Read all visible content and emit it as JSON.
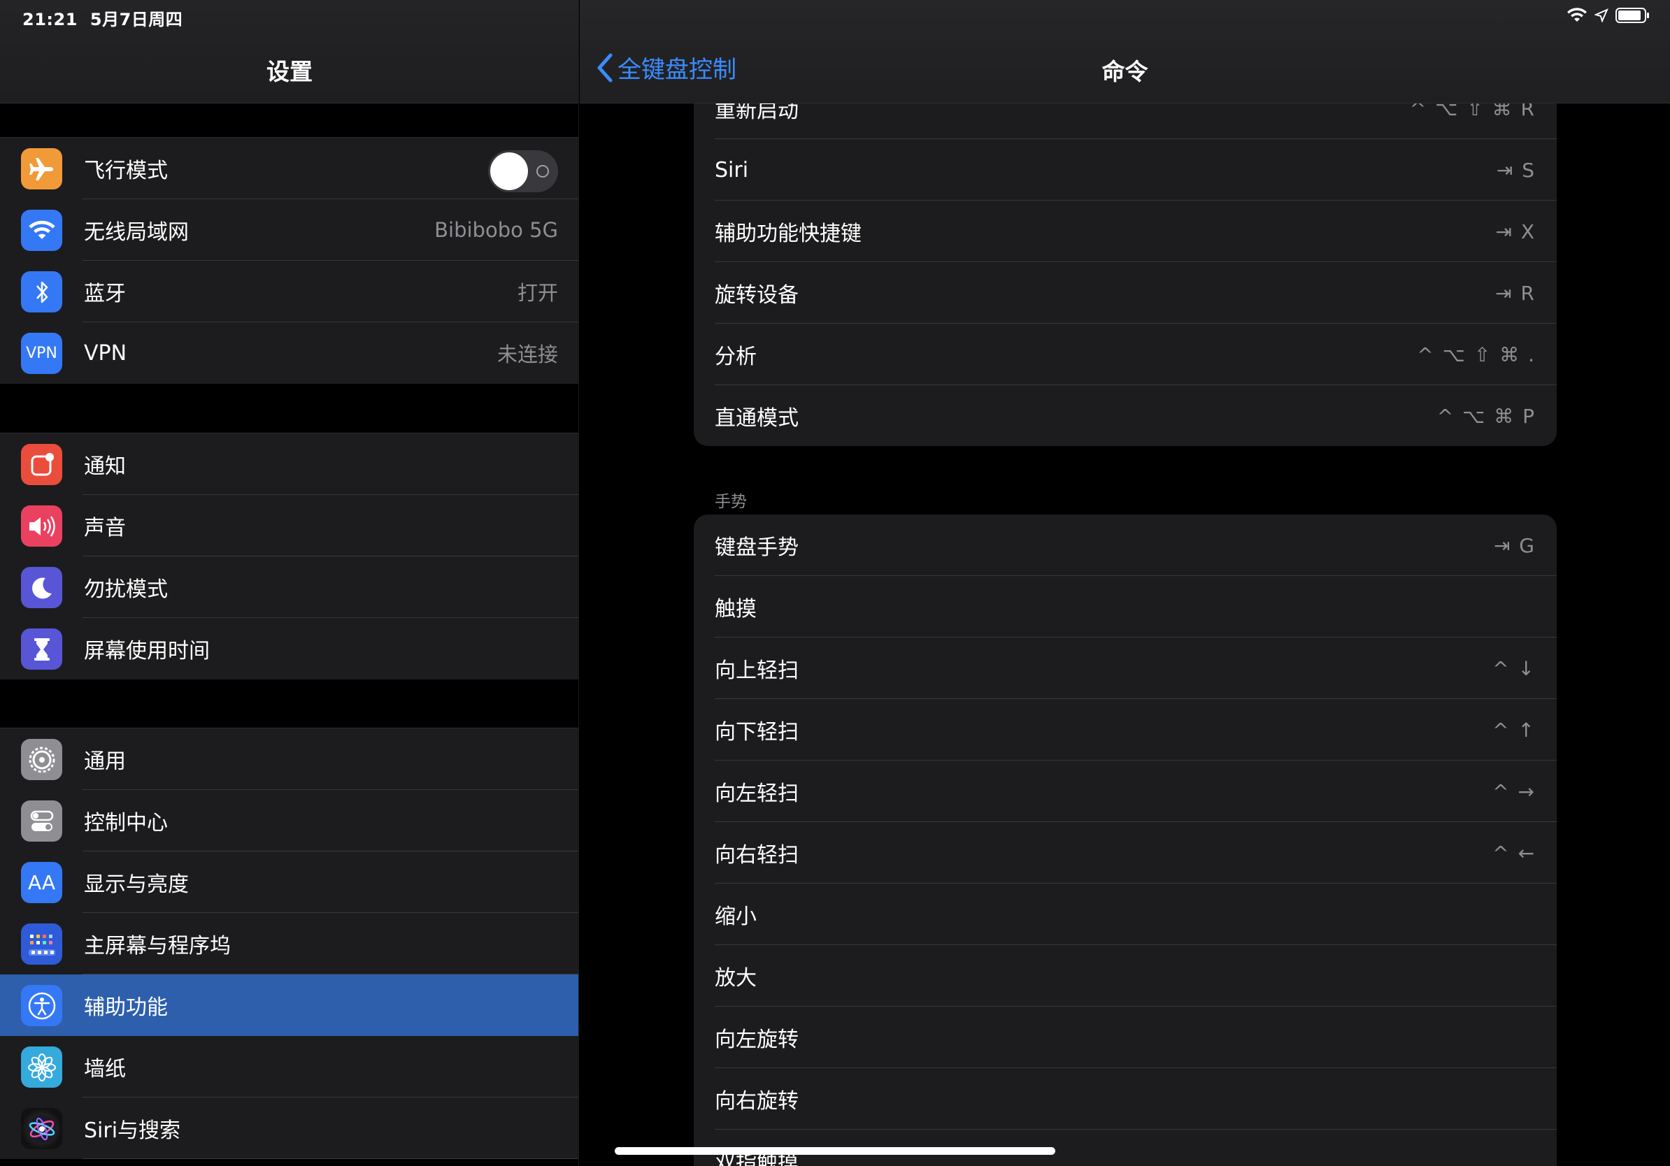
{
  "status_bar": {
    "time": "21:21",
    "date": "5月7日周四"
  },
  "sidebar": {
    "title": "设置",
    "groups": [
      [
        {
          "label": "飞行模式",
          "icon": "airplane-icon",
          "color": "#f19a38",
          "toggle": "off"
        },
        {
          "label": "无线局域网",
          "icon": "wifi-icon",
          "color": "#3478f6",
          "value": "Bibibobo 5G"
        },
        {
          "label": "蓝牙",
          "icon": "bluetooth-icon",
          "color": "#3478f6",
          "value": "打开"
        },
        {
          "label": "VPN",
          "icon": "vpn-icon",
          "color": "#3478f6",
          "icon_text": "VPN",
          "value": "未连接"
        }
      ],
      [
        {
          "label": "通知",
          "icon": "notifications-icon",
          "color": "#eb4d3d"
        },
        {
          "label": "声音",
          "icon": "sound-icon",
          "color": "#eb4160"
        },
        {
          "label": "勿扰模式",
          "icon": "moon-icon",
          "color": "#5856d6"
        },
        {
          "label": "屏幕使用时间",
          "icon": "hourglass-icon",
          "color": "#5856d6"
        }
      ],
      [
        {
          "label": "通用",
          "icon": "gear-icon",
          "color": "#8e8e93"
        },
        {
          "label": "控制中心",
          "icon": "control-center-icon",
          "color": "#8e8e93"
        },
        {
          "label": "显示与亮度",
          "icon": "display-icon",
          "color": "#3478f6",
          "icon_text": "AA"
        },
        {
          "label": "主屏幕与程序坞",
          "icon": "home-screen-icon",
          "color": "#2f5bd8"
        },
        {
          "label": "辅助功能",
          "icon": "accessibility-icon",
          "color": "#3478f6",
          "selected": true
        },
        {
          "label": "墙纸",
          "icon": "wallpaper-icon",
          "color": "#35aadc"
        },
        {
          "label": "Siri与搜索",
          "icon": "siri-icon",
          "color": "#222"
        }
      ]
    ]
  },
  "detail": {
    "back_label": "全键盘控制",
    "title": "命令",
    "card1": [
      {
        "label": "重新启动",
        "keys": "^ ⌥ ⇧ ⌘ R"
      },
      {
        "label": "Siri",
        "keys": "⇥ S"
      },
      {
        "label": "辅助功能快捷键",
        "keys": "⇥ X"
      },
      {
        "label": "旋转设备",
        "keys": "⇥ R"
      },
      {
        "label": "分析",
        "keys": "^ ⌥ ⇧ ⌘ ."
      },
      {
        "label": "直通模式",
        "keys": "^ ⌥ ⌘ P"
      }
    ],
    "section_gestures": "手势",
    "card2": [
      {
        "label": "键盘手势",
        "keys": "⇥ G"
      },
      {
        "label": "触摸",
        "keys": ""
      },
      {
        "label": "向上轻扫",
        "keys": "^ ↓"
      },
      {
        "label": "向下轻扫",
        "keys": "^ ↑"
      },
      {
        "label": "向左轻扫",
        "keys": "^ →"
      },
      {
        "label": "向右轻扫",
        "keys": "^ ←"
      },
      {
        "label": "缩小",
        "keys": ""
      },
      {
        "label": "放大",
        "keys": ""
      },
      {
        "label": "向左旋转",
        "keys": ""
      },
      {
        "label": "向右旋转",
        "keys": ""
      },
      {
        "label": "双指触摸",
        "keys": ""
      }
    ]
  }
}
